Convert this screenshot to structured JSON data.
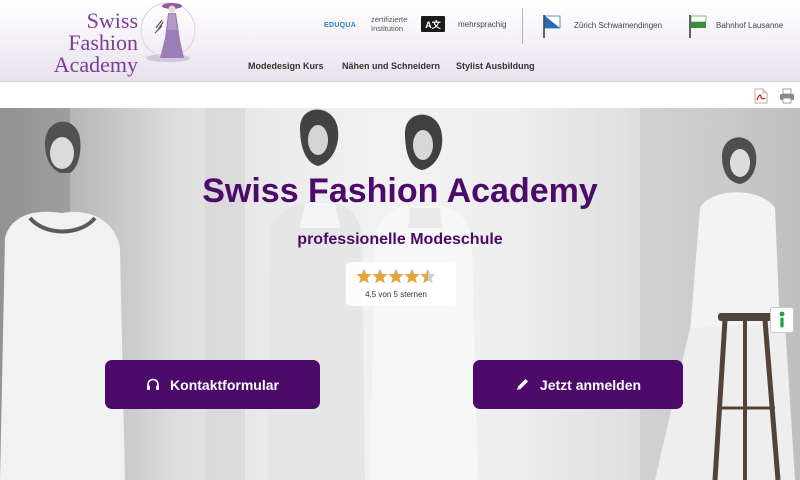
{
  "header": {
    "logo": {
      "line1": "Swiss Fashion",
      "line2": "Academy"
    },
    "badges": {
      "eduqua_label": "EDUQUA",
      "certified_text": "zertifizierte Institution",
      "language_icon_text": "A文",
      "language_text": "mehrsprachig"
    },
    "locations": [
      {
        "label": "Zürich Schwamendingen"
      },
      {
        "label": "Bahnhof Lausanne"
      }
    ],
    "nav": [
      {
        "label": "Modedesign Kurs"
      },
      {
        "label": "Nähen und Schneidern"
      },
      {
        "label": "Stylist Ausbildung"
      }
    ]
  },
  "toolbar": {
    "pdf_icon": "pdf-icon",
    "print_icon": "print-icon"
  },
  "hero": {
    "title": "Swiss Fashion Academy",
    "subtitle": "professionelle Modeschule",
    "rating": {
      "value": 4.5,
      "max": 5,
      "text": "4.5 von 5 sternen"
    },
    "buttons": {
      "contact": {
        "label": "Kontaktformular",
        "icon": "headset-icon"
      },
      "register": {
        "label": "Jetzt anmelden",
        "icon": "pencil-icon"
      }
    }
  },
  "colors": {
    "brand_purple": "#4c0a6b",
    "logo_purple": "#7a3d93",
    "star_orange": "#e8a23a"
  }
}
